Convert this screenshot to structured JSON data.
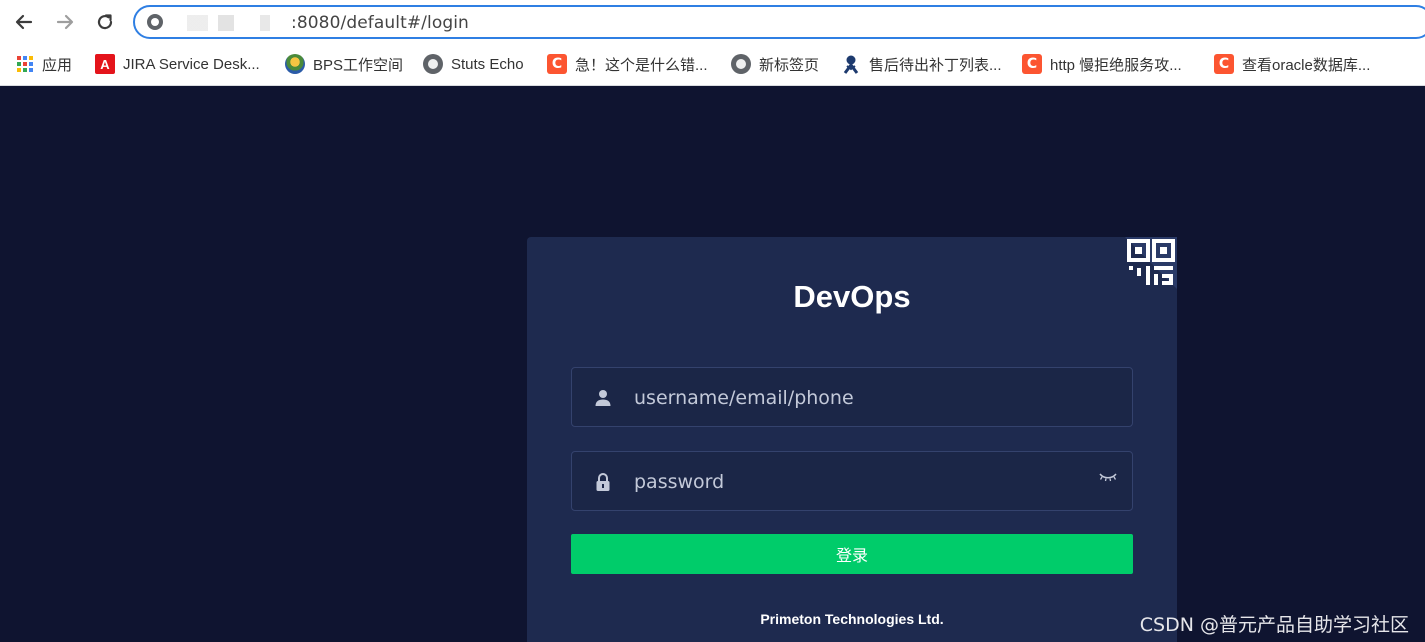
{
  "browser": {
    "url": ":8080/default#/login",
    "bookmarks": [
      {
        "label": "应用",
        "icon": "apps-grid-icon"
      },
      {
        "label": "JIRA Service Desk...",
        "icon": "jira-logo-icon"
      },
      {
        "label": "BPS工作空间",
        "icon": "bps-logo-icon"
      },
      {
        "label": "Stuts Echo",
        "icon": "globe-icon"
      },
      {
        "label": "急！这个是什么错...",
        "icon": "csdn-logo-icon"
      },
      {
        "label": "新标签页",
        "icon": "globe-icon"
      },
      {
        "label": "售后待出补丁列表...",
        "icon": "jenkins-logo-icon"
      },
      {
        "label": "http 慢拒绝服务攻...",
        "icon": "csdn-logo-icon"
      },
      {
        "label": "查看oracle数据库...",
        "icon": "csdn-logo-icon"
      }
    ],
    "csdn_glyph": "C",
    "jira_glyph": "A"
  },
  "login": {
    "title": "DevOps",
    "username_placeholder": "username/email/phone",
    "password_placeholder": "password",
    "submit_label": "登录",
    "footer": "Primeton Technologies Ltd."
  },
  "watermark": "CSDN @普元产品自助学习社区",
  "colors": {
    "page_bg": "#0f1430",
    "card_bg": "#1e2a4f",
    "button": "#00cc6a",
    "omnibox_focus": "#2f7fe3"
  }
}
